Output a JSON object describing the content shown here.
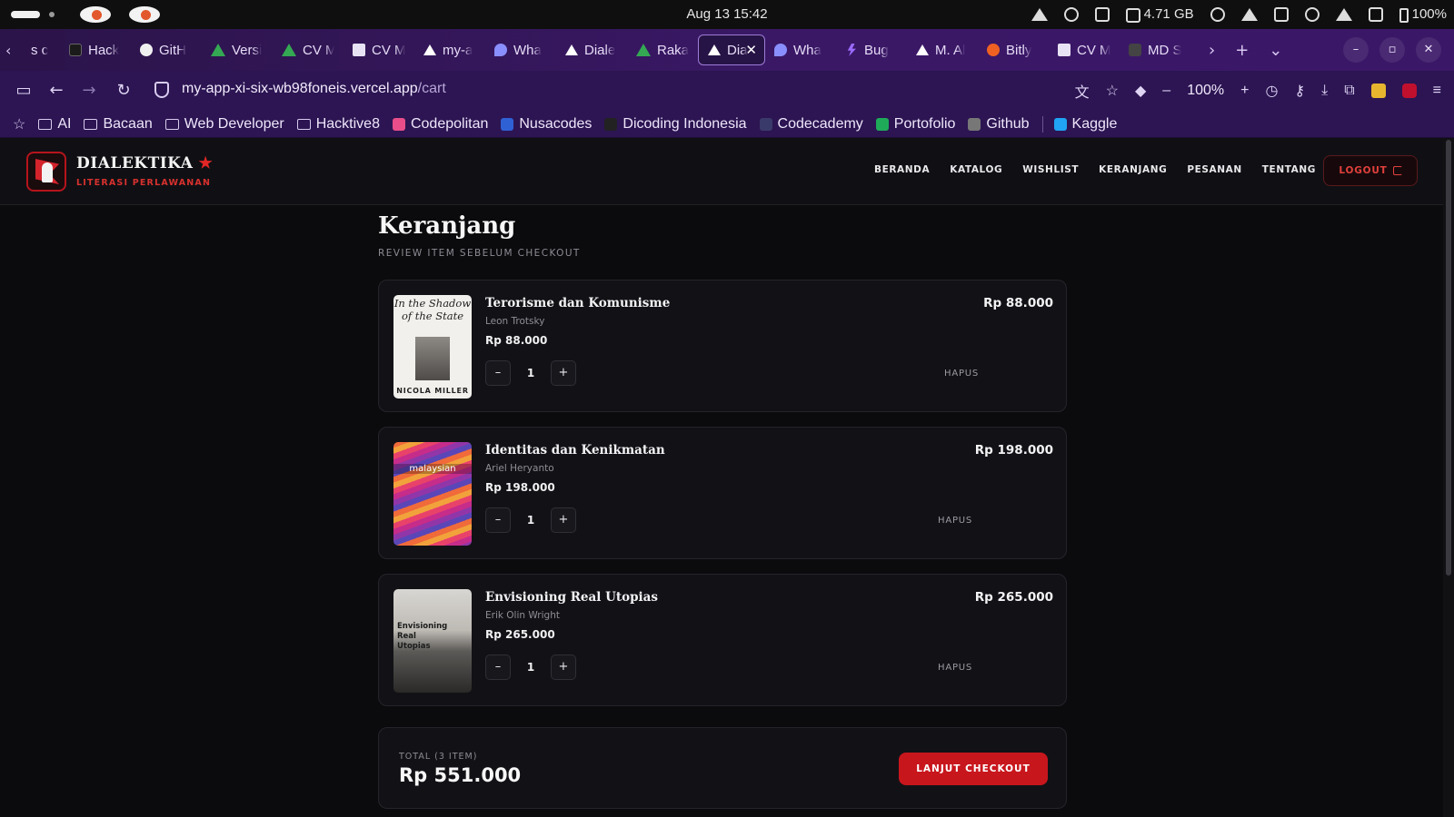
{
  "os": {
    "clock": "Aug 13  15:42",
    "memory": "4.71 GB",
    "battery": "100%"
  },
  "browser": {
    "tabs": [
      {
        "label": "s c",
        "icon": "chevron-left-icon"
      },
      {
        "label": "Hack",
        "icon": "hackerrank-icon"
      },
      {
        "label": "GitH",
        "icon": "github-icon"
      },
      {
        "label": "Versi",
        "icon": "drive-icon"
      },
      {
        "label": "CV M",
        "icon": "drive-icon"
      },
      {
        "label": "CV M",
        "icon": "doc-icon"
      },
      {
        "label": "my-a",
        "icon": "vercel-icon"
      },
      {
        "label": "Wha",
        "icon": "chat-icon"
      },
      {
        "label": "Diale",
        "icon": "vercel-icon"
      },
      {
        "label": "Raka",
        "icon": "drive-icon"
      },
      {
        "label": "Dia",
        "icon": "vercel-icon",
        "active": true
      },
      {
        "label": "Wha",
        "icon": "chat-icon"
      },
      {
        "label": "Bug",
        "icon": "bolt-icon"
      },
      {
        "label": "M. Al",
        "icon": "vercel-icon"
      },
      {
        "label": "Bitly",
        "icon": "bitly-icon"
      },
      {
        "label": "CV M",
        "icon": "doc-icon"
      },
      {
        "label": "MD S",
        "icon": "md-icon"
      }
    ],
    "url_host": "my-app-xi-six-wb98foneis.vercel.app",
    "url_path": "/cart",
    "zoom": "100%",
    "bookmarks": [
      "AI",
      "Bacaan",
      "Web Developer",
      "Hacktive8",
      "Codepolitan",
      "Nusacodes",
      "Dicoding Indonesia",
      "Codecademy",
      "Portofolio",
      "Github",
      "Kaggle"
    ]
  },
  "site": {
    "brand": "DIALEKTIKA",
    "tagline": "LITERASI PERLAWANAN",
    "nav": [
      "BERANDA",
      "KATALOG",
      "WISHLIST",
      "KERANJANG",
      "PESANAN",
      "TENTANG"
    ],
    "logout": "LOGOUT",
    "brand_color": "#c8161d"
  },
  "cart": {
    "title": "Keranjang",
    "subtitle": "REVIEW ITEM SEBELUM CHECKOUT",
    "remove_label": "HAPUS",
    "items": [
      {
        "title": "Terorisme dan Komunisme",
        "author": "Leon Trotsky",
        "price": "Rp 88.000",
        "qty": "1",
        "subtotal": "Rp 88.000",
        "cover_title": "In the Shadow of the State",
        "cover_author": "NICOLA MILLER"
      },
      {
        "title": "Identitas dan Kenikmatan",
        "author": "Ariel Heryanto",
        "price": "Rp 198.000",
        "qty": "1",
        "subtotal": "Rp 198.000",
        "cover_title": "malaysian"
      },
      {
        "title": "Envisioning Real Utopias",
        "author": "Erik Olin Wright",
        "price": "Rp 265.000",
        "qty": "1",
        "subtotal": "Rp 265.000",
        "cover_title": "Envisioning Real Utopias"
      }
    ],
    "total_label": "TOTAL (3 ITEM)",
    "total": "Rp 551.000",
    "checkout": "LANJUT CHECKOUT"
  }
}
